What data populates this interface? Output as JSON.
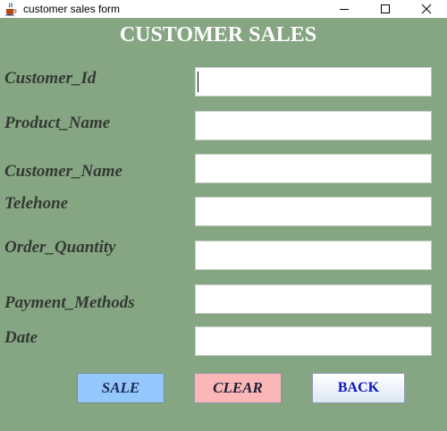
{
  "window": {
    "title": "customer sales form",
    "icon": "java-cup-icon",
    "controls": [
      "minimize",
      "maximize",
      "close"
    ]
  },
  "form": {
    "heading": "CUSTOMER SALES",
    "fields": [
      {
        "label": "Customer_Id",
        "value": ""
      },
      {
        "label": "Product_Name",
        "value": ""
      },
      {
        "label": "Customer_Name",
        "value": ""
      },
      {
        "label": "Telehone",
        "value": ""
      },
      {
        "label": "Order_Quantity",
        "value": ""
      },
      {
        "label": "Payment_Methods",
        "value": ""
      },
      {
        "label": "Date",
        "value": ""
      }
    ],
    "buttons": {
      "sale": "SALE",
      "clear": "CLEAR",
      "back": "BACK"
    }
  },
  "colors": {
    "panel_background": "#86a683",
    "heading": "#ffffff",
    "label_text": "#333a33",
    "sale_button": "#94c7fb",
    "clear_button": "#fbb7b7",
    "back_text": "#0b16c0"
  }
}
